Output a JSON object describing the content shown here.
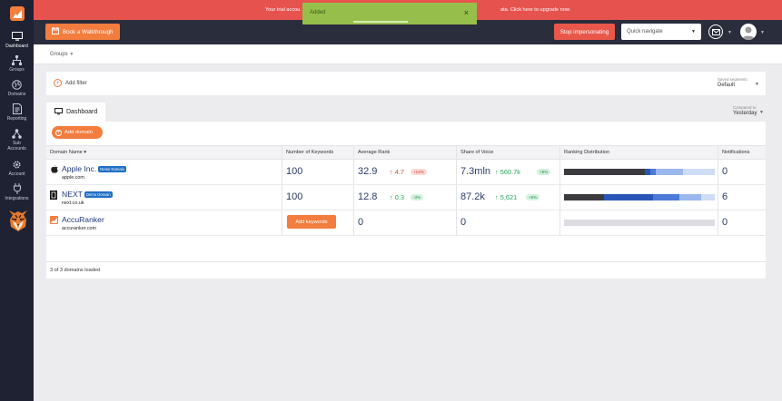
{
  "sidebar": {
    "items": [
      {
        "label": "Dashboard",
        "icon": "monitor-icon"
      },
      {
        "label": "Groups",
        "icon": "hierarchy-icon"
      },
      {
        "label": "Domains",
        "icon": "globe-icon"
      },
      {
        "label": "Reporting",
        "icon": "report-icon"
      },
      {
        "label": "Sub Accounts",
        "icon": "sub-accounts-icon"
      },
      {
        "label": "Account",
        "icon": "gear-icon"
      },
      {
        "label": "Integrations",
        "icon": "plug-icon"
      }
    ]
  },
  "banner": {
    "text_left": "Your trial accou",
    "text_right": "ata. Click here to upgrade now."
  },
  "toast": {
    "message": "Added",
    "close": "×"
  },
  "topbar": {
    "walkthrough_label": "Book a Walkthrough",
    "stop_label": "Stop impersonating",
    "quick_navigate_placeholder": "Quick navigate"
  },
  "breadcrumb": {
    "groups": "Groups"
  },
  "filters": {
    "add_filter": "Add filter",
    "saved_segments_label": "Saved segments",
    "saved_segments_value": "Default"
  },
  "dashboard": {
    "tab_label": "Dashboard",
    "compared_label": "Compared to",
    "compared_value": "Yesterday",
    "add_domain": "Add domain",
    "add_keywords": "Add keywords",
    "footer": "3 of 3 domains loaded"
  },
  "table": {
    "columns": {
      "domain": "Domain Name ▾",
      "keywords": "Number of Keywords",
      "rank": "Average Rank",
      "sov": "Share of Voice",
      "dist": "Ranking Distribution",
      "notif": "Notifications"
    },
    "rows": [
      {
        "name": "Apple Inc.",
        "badge": "Demo Domain",
        "url": "apple.com",
        "keywords": "100",
        "rank": "32.9",
        "rank_change": "↑ 4.7",
        "rank_pct": "+14%",
        "sov": "7.3mln",
        "sov_change": "↑ 560.7k",
        "sov_pct": "+8%",
        "notifications": "0"
      },
      {
        "name": "NEXT",
        "badge": "Demo Domain",
        "url": "next.co.uk",
        "keywords": "100",
        "rank": "12.8",
        "rank_change": "↑ 0.3",
        "rank_pct": "-3%",
        "sov": "87.2k",
        "sov_change": "↑ 5,621",
        "sov_pct": "+6%",
        "notifications": "6"
      },
      {
        "name": "AccuRanker",
        "url": "accuranker.com",
        "rank": "0",
        "sov": "0",
        "notifications": "0"
      }
    ]
  },
  "colors": {
    "brand_orange": "#f27d3e",
    "banner_red": "#e6534f",
    "toast_green": "#95bf4a",
    "dark_nav": "#1f2233",
    "positive": "#28a35b",
    "negative": "#d94a40"
  }
}
